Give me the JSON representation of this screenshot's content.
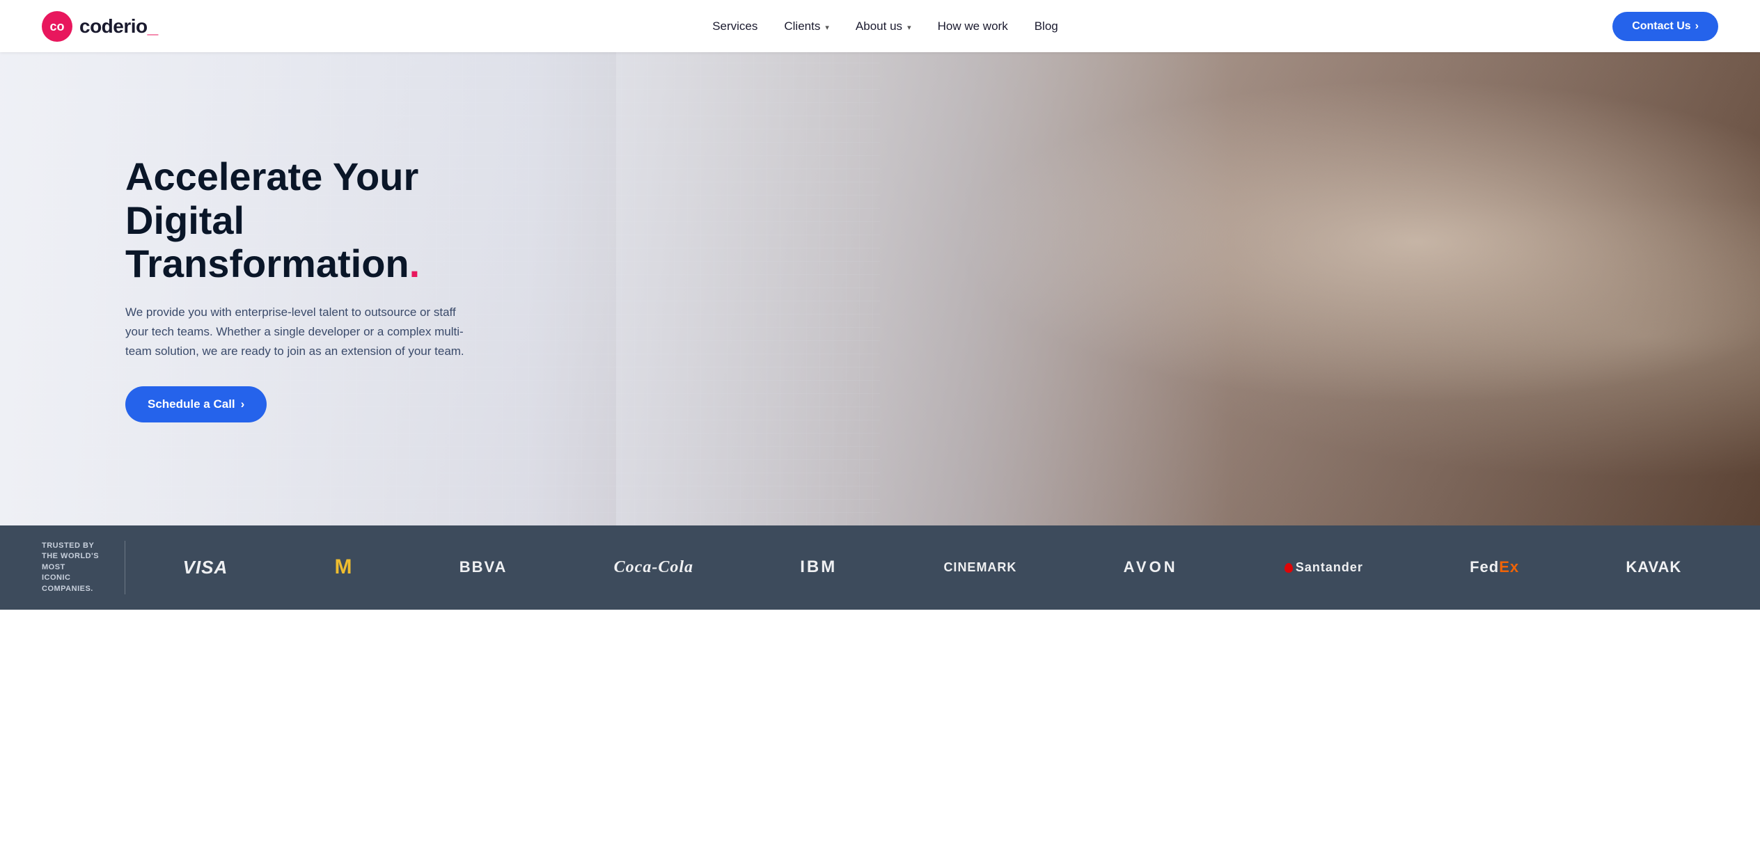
{
  "brand": {
    "name": "coderio_",
    "namePrefix": "coderio",
    "nameSuffix": "_"
  },
  "navbar": {
    "logo_alt": "Coderio Logo",
    "links": [
      {
        "label": "Services",
        "hasDropdown": false
      },
      {
        "label": "Clients",
        "hasDropdown": true
      },
      {
        "label": "About us",
        "hasDropdown": true
      },
      {
        "label": "How we work",
        "hasDropdown": false
      },
      {
        "label": "Blog",
        "hasDropdown": false
      }
    ],
    "cta_label": "Contact Us",
    "cta_arrow": "›"
  },
  "hero": {
    "title_line1": "Accelerate Your",
    "title_line2": "Digital Transformation",
    "title_dot": ".",
    "description": "We provide you with enterprise-level talent to outsource or staff your tech teams. Whether a single developer or a complex multi-team solution, we are ready to join as an extension of your team.",
    "cta_label": "Schedule a Call",
    "cta_arrow": "›"
  },
  "trusted_bar": {
    "text_line1": "TRUSTED BY THE WORLD'S MOST",
    "text_line2": "ICONIC COMPANIES.",
    "logos": [
      {
        "name": "Visa",
        "class": "visa",
        "display": "VISA"
      },
      {
        "name": "McDonalds",
        "class": "mcdonalds",
        "display": "M"
      },
      {
        "name": "BBVA",
        "class": "bbva",
        "display": "BBVA"
      },
      {
        "name": "Coca-Cola",
        "class": "cocacola",
        "display": "Coca-Cola"
      },
      {
        "name": "IBM",
        "class": "ibm",
        "display": "IBM"
      },
      {
        "name": "Cinemark",
        "class": "cinemark",
        "display": "CINEMARK"
      },
      {
        "name": "Avon",
        "class": "avon",
        "display": "AVON"
      },
      {
        "name": "Santander",
        "class": "santander",
        "display": "Santander"
      },
      {
        "name": "FedEx",
        "class": "fedex",
        "display": "FedEx"
      },
      {
        "name": "Kavak",
        "class": "kavak",
        "display": "KAVAK"
      }
    ]
  }
}
